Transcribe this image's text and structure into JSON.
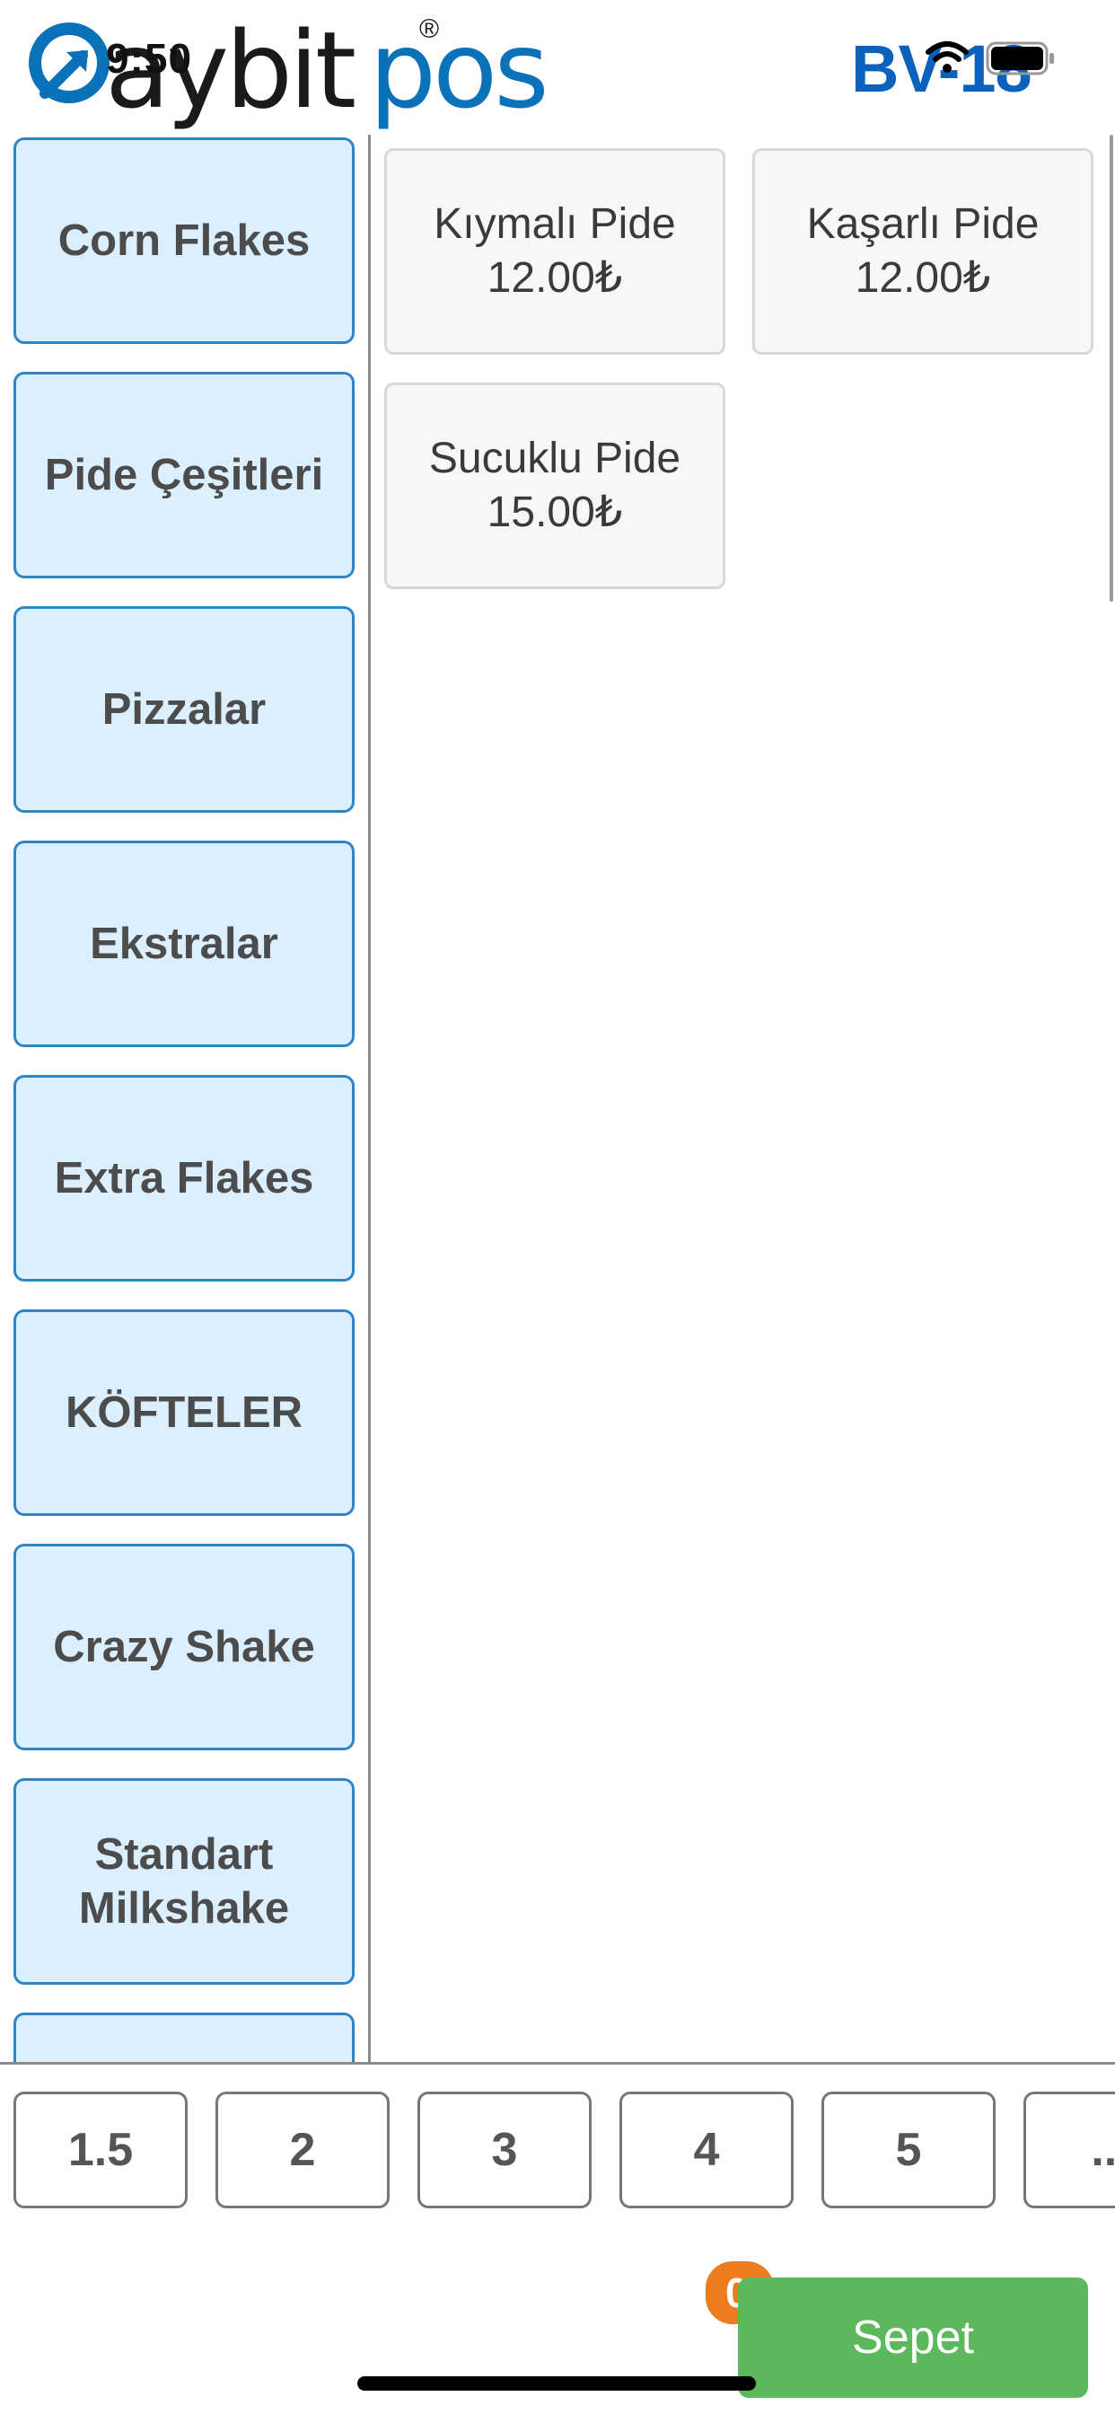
{
  "status_bar": {
    "time": "9:50"
  },
  "brand": {
    "logo_part1": "aybit",
    "logo_part2": "pos",
    "registered_mark": "®",
    "accent_color": "#0a72b8",
    "device_code": "BV-18"
  },
  "categories": [
    {
      "label": "Corn Flakes"
    },
    {
      "label": "Pide Çeşitleri"
    },
    {
      "label": "Pizzalar"
    },
    {
      "label": "Ekstralar"
    },
    {
      "label": "Extra Flakes"
    },
    {
      "label": "KÖFTELER"
    },
    {
      "label": "Crazy Shake"
    },
    {
      "label": "Standart Milkshake"
    },
    {
      "label": ""
    }
  ],
  "products": [
    {
      "name": "Kıymalı Pide",
      "price": "12.00₺"
    },
    {
      "name": "Kaşarlı Pide",
      "price": "12.00₺"
    },
    {
      "name": "Sucuklu Pide",
      "price": "15.00₺"
    }
  ],
  "quantities": [
    "1.5",
    "2",
    "3",
    "4",
    "5",
    "..."
  ],
  "basket": {
    "label": "Sepet",
    "count": "0",
    "button_color": "#5cb85c",
    "badge_color": "#ec7d1f"
  },
  "category_color": "#dcefff"
}
